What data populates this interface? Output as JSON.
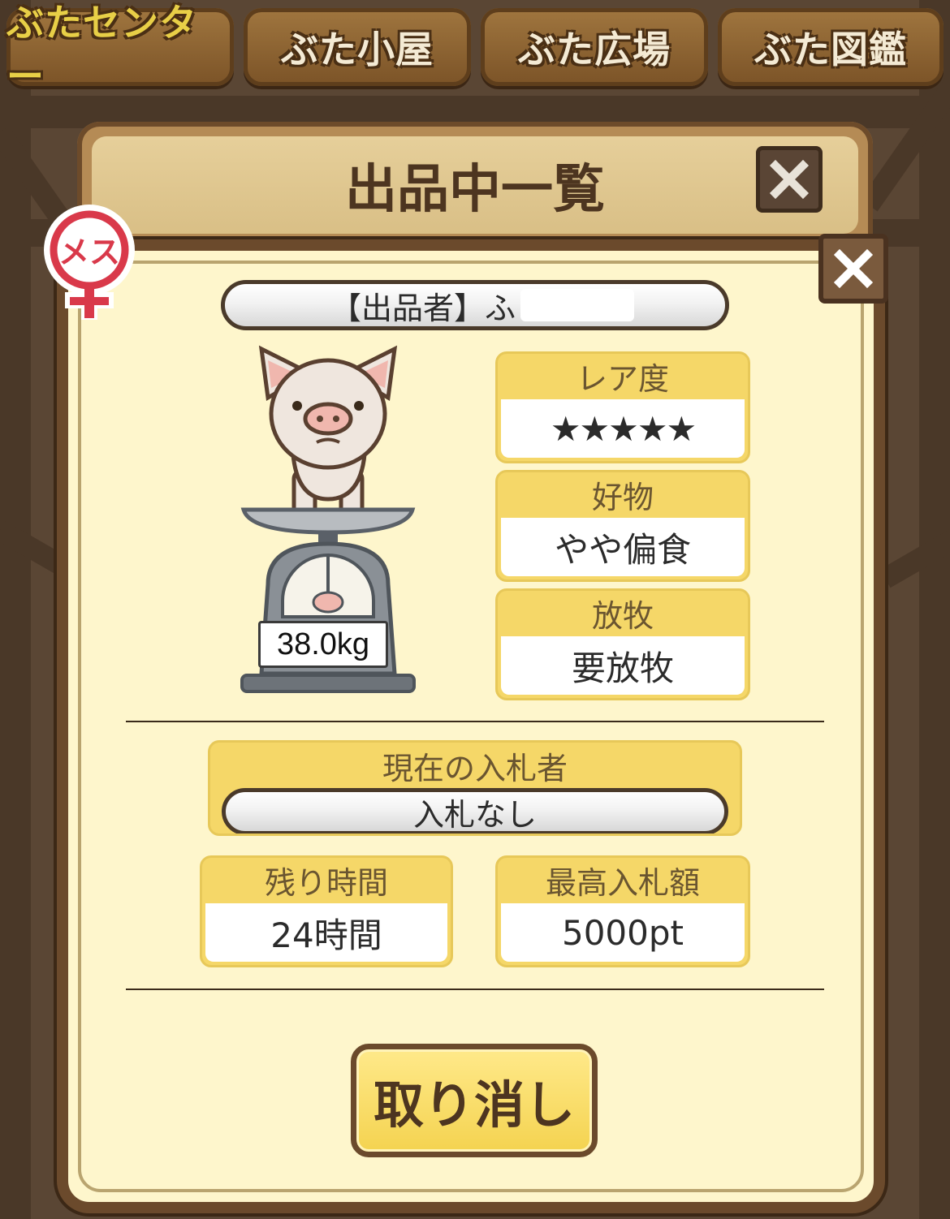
{
  "tabs": [
    {
      "label": "ぶたセンター",
      "active": true
    },
    {
      "label": "ぶた小屋",
      "active": false
    },
    {
      "label": "ぶた広場",
      "active": false
    },
    {
      "label": "ぶた図鑑",
      "active": false
    }
  ],
  "listing_panel": {
    "title": "出品中一覧"
  },
  "detail": {
    "gender_badge": "メス",
    "seller": "【出品者】ふ",
    "weight": "38.0kg",
    "rarity": {
      "label": "レア度",
      "stars": "★★★★★"
    },
    "favorite": {
      "label": "好物",
      "value": "やや偏食"
    },
    "grazing": {
      "label": "放牧",
      "value": "要放牧"
    },
    "current_bidder": {
      "label": "現在の入札者",
      "value": "入札なし"
    },
    "time_left": {
      "label": "残り時間",
      "value": "24時間"
    },
    "max_bid": {
      "label": "最高入札額",
      "value": "5000pt"
    },
    "cancel_label": "取り消し"
  },
  "colors": {
    "panel_bg": "#fef6cc",
    "label_bg": "#f5d768",
    "frame": "#6b4a2c",
    "star": "#e48a82",
    "female": "#d9394a"
  }
}
